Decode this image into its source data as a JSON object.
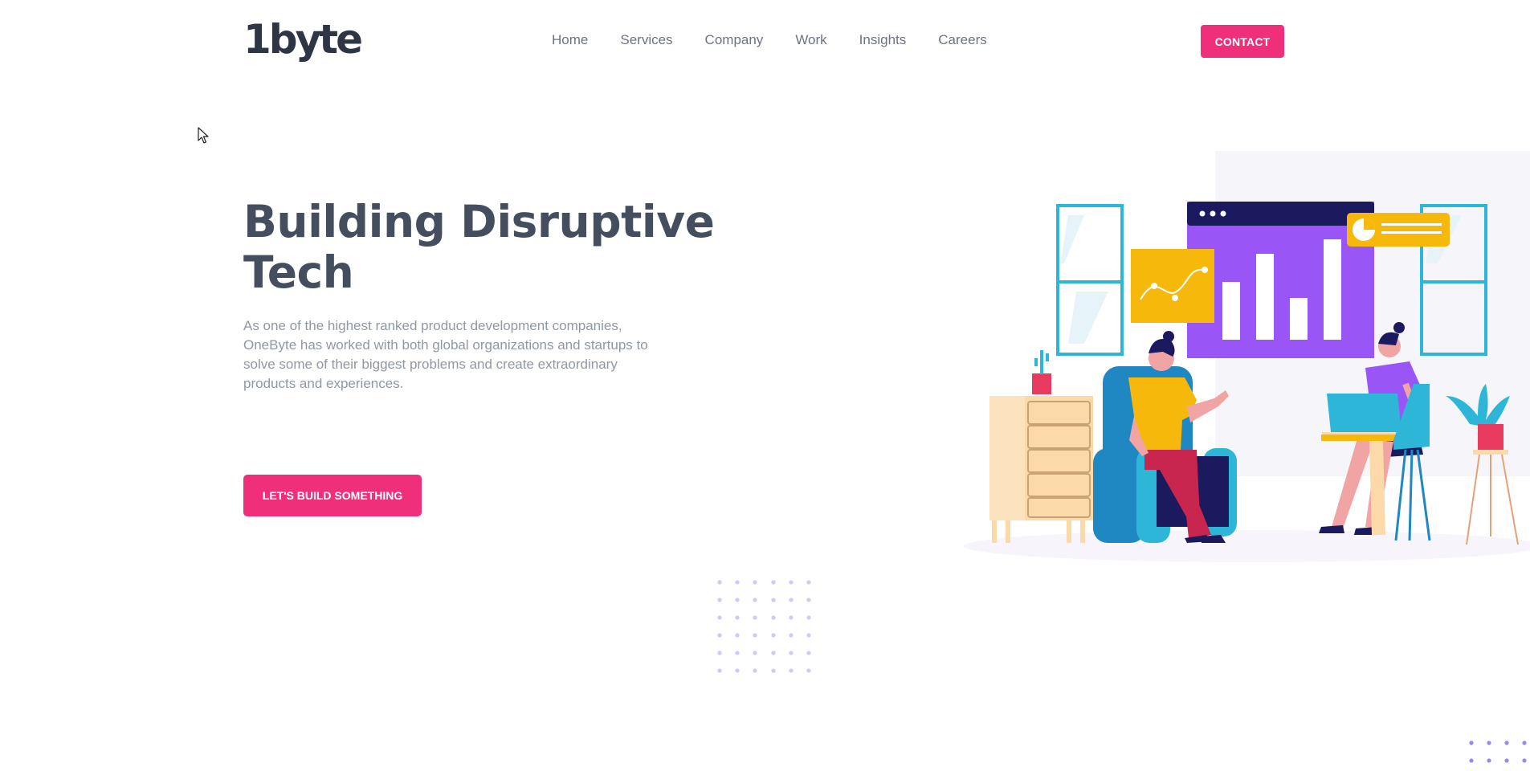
{
  "header": {
    "logo": "1byte",
    "nav": [
      "Home",
      "Services",
      "Company",
      "Work",
      "Insights",
      "Careers"
    ],
    "contact_label": "CONTACT"
  },
  "hero": {
    "title_line1": "Building Disruptive",
    "title_line2": "Tech",
    "description": "As one of the highest ranked product development companies, OneByte has worked with both global organizations and startups to solve some of their biggest problems and create extraordinary products and experiences.",
    "cta_label": "LET'S BUILD SOMETHING"
  },
  "colors": {
    "accent": "#ef2f7a",
    "heading": "#454e5f",
    "text_muted": "#9098a3",
    "dots": "#c9cdf5"
  },
  "icons": {
    "cursor": "mouse-pointer-icon"
  }
}
